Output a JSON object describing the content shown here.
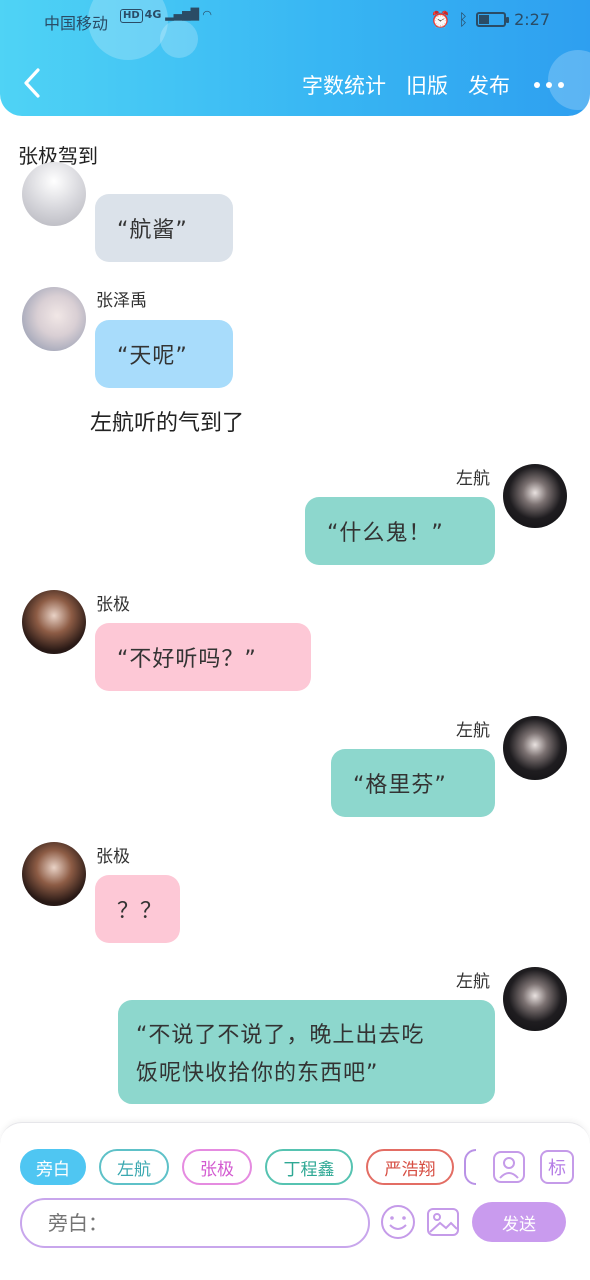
{
  "status_bar": {
    "carrier": "中国移动",
    "network_hd": "HD",
    "network_gen": "4G",
    "time": "2:27"
  },
  "header": {
    "back_icon": "chevron-left-icon",
    "word_count": "字数统计",
    "old_version": "旧版",
    "publish": "发布",
    "more_icon": "ellipsis-icon"
  },
  "chat_title": "张极驾到",
  "messages": [
    {
      "speaker": "",
      "text": "“航酱”",
      "side": "left",
      "color": "#dbe2ea"
    },
    {
      "speaker": "张泽禹",
      "text": "“天呢”",
      "side": "left",
      "color": "#a8dcfb"
    },
    {
      "narration": "左航听的气到了"
    },
    {
      "speaker": "左航",
      "text": "“什么鬼！”",
      "side": "right",
      "color": "#8dd7cd"
    },
    {
      "speaker": "张极",
      "text": "“不好听吗？”",
      "side": "left",
      "color": "#fdc8d6"
    },
    {
      "speaker": "左航",
      "text": "“格里芬”",
      "side": "right",
      "color": "#8dd7cd"
    },
    {
      "speaker": "张极",
      "text": "？？",
      "side": "left",
      "color": "#fdc8d6"
    },
    {
      "speaker": "左航",
      "text_line1": "“不说了不说了，晚上出去吃",
      "text_line2": "饭呢快收拾你的东西吧”",
      "side": "right",
      "color": "#8dd7cd"
    }
  ],
  "composer": {
    "chips": [
      "旁白",
      "左航",
      "张极",
      "丁程鑫",
      "严浩翔"
    ],
    "tag_label": "标",
    "input_placeholder": "旁白：",
    "send": "发送"
  }
}
